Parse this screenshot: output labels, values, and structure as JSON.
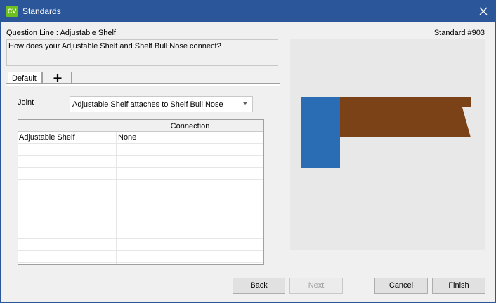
{
  "window": {
    "app_icon_text": "CV",
    "title": "Standards"
  },
  "header": {
    "question_line": "Question Line : Adjustable Shelf",
    "standard_number": "Standard #903",
    "question": "How does your Adjustable Shelf and Shelf Bull Nose connect?"
  },
  "tabs": [
    {
      "label": "Default",
      "selected": true
    },
    {
      "label": "+",
      "icon": "plus-icon"
    }
  ],
  "joint": {
    "label": "Joint",
    "selected_value": "Adjustable Shelf attaches to Shelf Bull Nose"
  },
  "grid": {
    "column_header": "Connection",
    "rows": [
      {
        "part": "Adjustable Shelf",
        "connection": "None"
      }
    ]
  },
  "preview": {
    "colors": {
      "post": "#2a6db5",
      "shelf": "#7b4218",
      "background": "#e8e8e8"
    }
  },
  "buttons": {
    "back": "Back",
    "next": "Next",
    "cancel": "Cancel",
    "finish": "Finish"
  }
}
